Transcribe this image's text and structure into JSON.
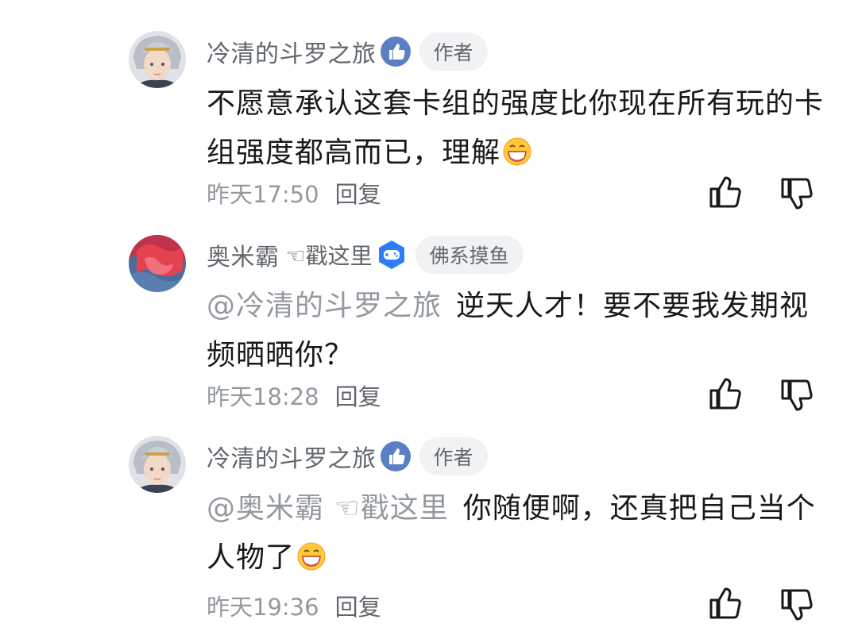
{
  "comments": [
    {
      "username": "冷清的斗罗之旅",
      "fan_tag": "",
      "level_icon": "thumbs-up-badge-icon",
      "tag": "作者",
      "mention": "",
      "text": "不愿意承认这套卡组的强度比你现在所有玩的卡组强度都高而已，理解",
      "emoji": "grin-emoji",
      "time": "昨天17:50",
      "reply_label": "回复"
    },
    {
      "username": "奥米霸",
      "fan_tag": "☜戳这里",
      "level_icon": "gamepad-badge-icon",
      "tag": "佛系摸鱼",
      "mention": "@冷清的斗罗之旅",
      "text": "逆天人才！要不要我发期视频晒晒你？",
      "emoji": "",
      "time": "昨天18:28",
      "reply_label": "回复"
    },
    {
      "username": "冷清的斗罗之旅",
      "fan_tag": "",
      "level_icon": "thumbs-up-badge-icon",
      "tag": "作者",
      "mention": "@奥米霸 ☜戳这里",
      "text": "你随便啊，还真把自己当个人物了",
      "emoji": "grin-emoji",
      "time": "昨天19:36",
      "reply_label": "回复"
    }
  ],
  "icons": {
    "like": "thumbs-up-icon",
    "dislike": "thumbs-down-icon"
  },
  "colors": {
    "name": "#61666d",
    "meta": "#9499a0",
    "text": "#18191c",
    "pill_bg": "#f1f2f3",
    "badge_blue": "#2f7df6"
  }
}
